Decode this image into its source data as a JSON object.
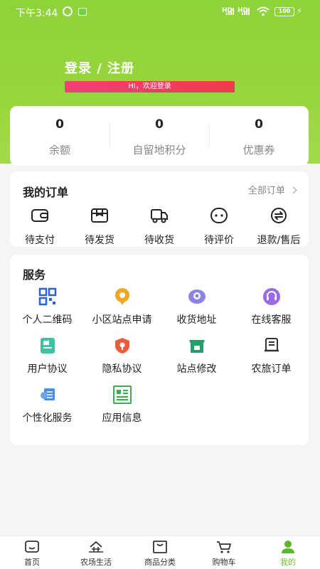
{
  "status_bar": {
    "time": "下午3:44",
    "net1": "HD",
    "net2": "HD",
    "battery": "100"
  },
  "header": {
    "login_title": "登录 / 注册",
    "login_banner": "HI，欢迎登录",
    "accent_color": "#8dd33a"
  },
  "wallet": [
    {
      "value": "0",
      "label": "余额"
    },
    {
      "value": "0",
      "label": "自留地积分"
    },
    {
      "value": "0",
      "label": "优惠券"
    }
  ],
  "orders": {
    "title": "我的订单",
    "all_label": "全部订单",
    "items": [
      {
        "label": "待支付",
        "icon": "wallet-icon"
      },
      {
        "label": "待发货",
        "icon": "package-icon"
      },
      {
        "label": "待收货",
        "icon": "truck-icon"
      },
      {
        "label": "待评价",
        "icon": "comment-icon"
      },
      {
        "label": "退款/售后",
        "icon": "refund-icon"
      }
    ]
  },
  "service": {
    "title": "服务",
    "items": [
      {
        "label": "个人二维码",
        "icon": "qr-code-icon"
      },
      {
        "label": "小区站点申请",
        "icon": "location-pin-icon"
      },
      {
        "label": "收货地址",
        "icon": "address-icon"
      },
      {
        "label": "在线客服",
        "icon": "headset-icon"
      },
      {
        "label": "用户协议",
        "icon": "document-icon"
      },
      {
        "label": "隐私协议",
        "icon": "privacy-shield-icon"
      },
      {
        "label": "站点修改",
        "icon": "store-icon"
      },
      {
        "label": "农旅订单",
        "icon": "ticket-icon"
      },
      {
        "label": "个性化服务",
        "icon": "personalize-icon"
      },
      {
        "label": "应用信息",
        "icon": "app-info-icon"
      }
    ]
  },
  "tabbar": [
    {
      "label": "首页",
      "icon": "home-icon",
      "active": false
    },
    {
      "label": "农场生活",
      "icon": "farm-icon",
      "active": false
    },
    {
      "label": "商品分类",
      "icon": "category-icon",
      "active": false
    },
    {
      "label": "购物车",
      "icon": "cart-icon",
      "active": false
    },
    {
      "label": "我的",
      "icon": "profile-icon",
      "active": true
    }
  ]
}
